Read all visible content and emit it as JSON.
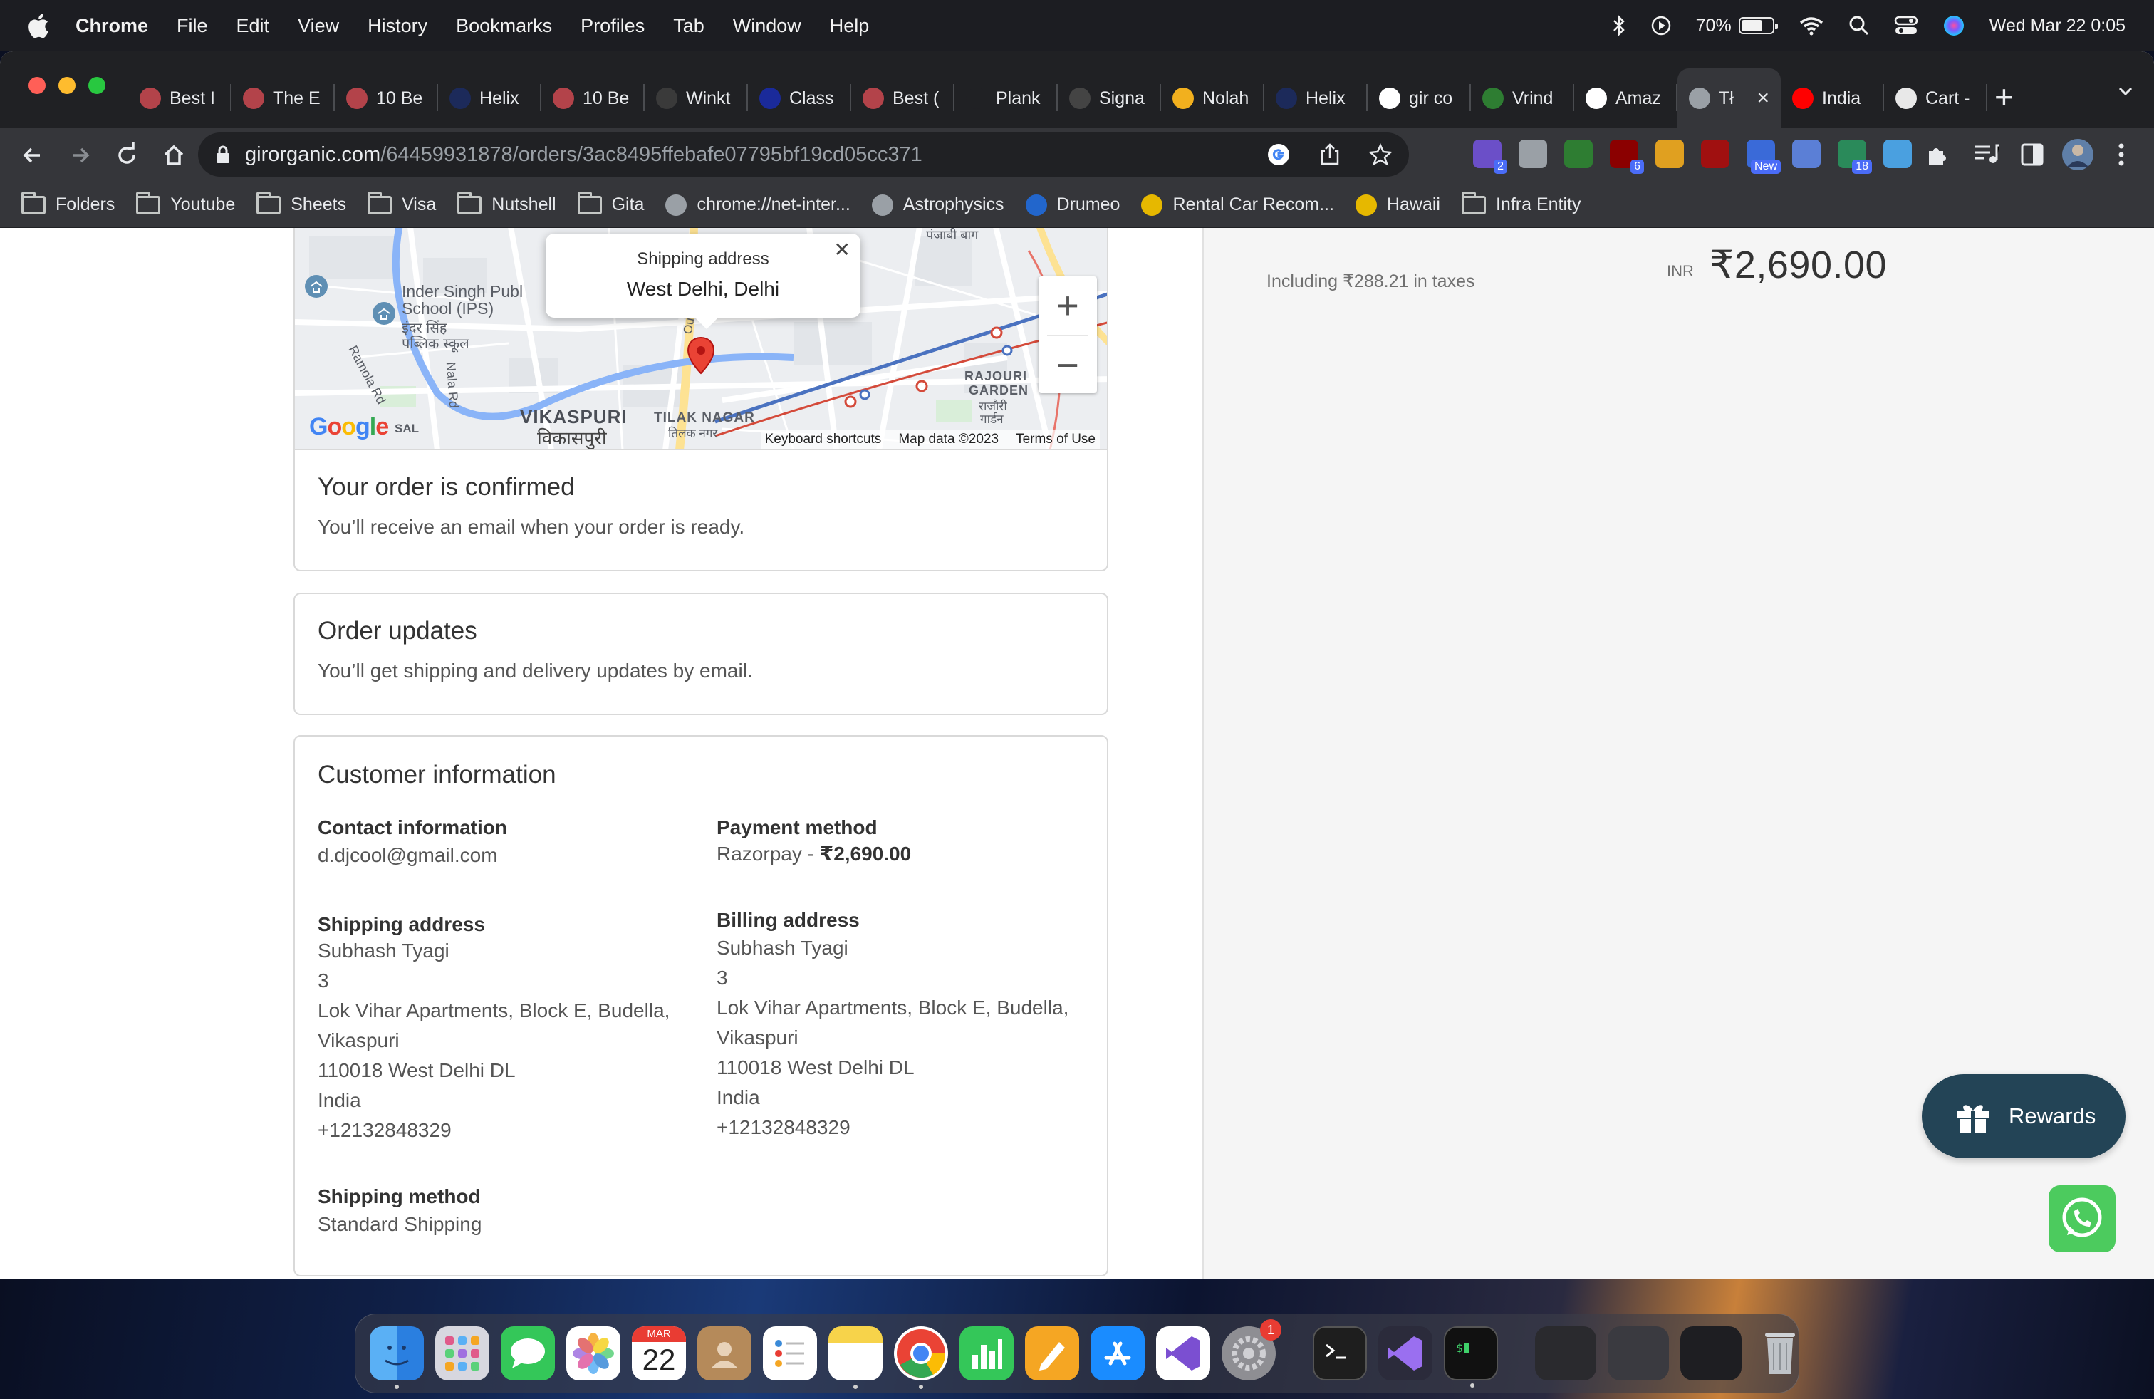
{
  "menubar": {
    "app_name": "Chrome",
    "items": [
      "File",
      "Edit",
      "View",
      "History",
      "Bookmarks",
      "Profiles",
      "Tab",
      "Window",
      "Help"
    ],
    "battery": "70%",
    "battery_level": 0.7,
    "clock": "Wed Mar 22  0:05"
  },
  "tabs": [
    {
      "title": "Best I",
      "fav_color": "#b3434a",
      "icon": "reddit-like-icon"
    },
    {
      "title": "The E",
      "fav_color": "#b3434a",
      "icon": "reddit-like-icon"
    },
    {
      "title": "10 Be",
      "fav_color": "#b3434a",
      "icon": "reddit-like-icon"
    },
    {
      "title": "Helix",
      "fav_color": "#1c2a5a",
      "icon": "helix-icon"
    },
    {
      "title": "10 Be",
      "fav_color": "#b3434a",
      "icon": "reddit-like-icon"
    },
    {
      "title": "Winkt",
      "fav_color": "#3a3a3a",
      "icon": "wikipedia-icon"
    },
    {
      "title": "Class",
      "fav_color": "#1a2a9a",
      "icon": "class-icon"
    },
    {
      "title": "Best (",
      "fav_color": "#b3434a",
      "icon": "reddit-like-icon"
    },
    {
      "title": "Plank",
      "fav_color": "#202124",
      "icon": "plank-icon"
    },
    {
      "title": "Signa",
      "fav_color": "#444444",
      "icon": "signal-icon"
    },
    {
      "title": "Nolah",
      "fav_color": "#f2b01e",
      "icon": "nolah-icon"
    },
    {
      "title": "Helix",
      "fav_color": "#1c2a5a",
      "icon": "helix-icon"
    },
    {
      "title": "gir co",
      "fav_color": "#ffffff",
      "icon": "google-icon"
    },
    {
      "title": "Vrind",
      "fav_color": "#2e7d32",
      "icon": "vrindavan-icon"
    },
    {
      "title": "Amaz",
      "fav_color": "#ffffff",
      "icon": "amazon-icon"
    },
    {
      "title": "Tł",
      "fav_color": "#9aa0a6",
      "icon": "globe-icon",
      "active": true
    },
    {
      "title": "India",
      "fav_color": "#ff0000",
      "icon": "youtube-icon"
    },
    {
      "title": "Cart -",
      "fav_color": "#e8e8e8",
      "icon": "cart-icon"
    }
  ],
  "omnibox": {
    "host": "girorganic.com",
    "path": "/64459931878/orders/3ac8495ffebafe07795bf19cd05cc371"
  },
  "extensions": [
    {
      "color": "#6b4fc8",
      "badge": "2",
      "icon": "ext-p-icon"
    },
    {
      "color": "#9aa0a6",
      "badge": "",
      "icon": "ext-translate-icon"
    },
    {
      "color": "#2e7d32",
      "badge": "",
      "icon": "ext-dollar-icon"
    },
    {
      "color": "#8b0000",
      "badge": "6",
      "icon": "ublock-icon"
    },
    {
      "color": "#e0a020",
      "badge": "",
      "icon": "ext-stack-icon"
    },
    {
      "color": "#a01010",
      "badge": "",
      "icon": "ext-y-icon"
    },
    {
      "color": "#3a6ad8",
      "badge": "New",
      "icon": "ext-new-icon"
    },
    {
      "color": "#5b7fd6",
      "badge": "",
      "icon": "ext-cloud-icon"
    },
    {
      "color": "#2a8a5a",
      "badge": "18",
      "icon": "ext-arrow-icon"
    },
    {
      "color": "#4aa0e0",
      "badge": "",
      "icon": "ext-square-icon"
    }
  ],
  "bookmarks": [
    {
      "label": "Folders",
      "type": "folder"
    },
    {
      "label": "Youtube",
      "type": "folder"
    },
    {
      "label": "Sheets",
      "type": "folder"
    },
    {
      "label": "Visa",
      "type": "folder"
    },
    {
      "label": "Nutshell",
      "type": "folder"
    },
    {
      "label": "Gita",
      "type": "folder"
    },
    {
      "label": "chrome://net-inter...",
      "type": "site",
      "color": "#9aa0a6"
    },
    {
      "label": "Astrophysics",
      "type": "site",
      "color": "#9aa0a6"
    },
    {
      "label": "Drumeo",
      "type": "site",
      "color": "#2266cc"
    },
    {
      "label": "Rental Car Recom...",
      "type": "site",
      "color": "#e6b800"
    },
    {
      "label": "Hawaii",
      "type": "site",
      "color": "#e6b800"
    },
    {
      "label": "Infra Entity",
      "type": "folder"
    }
  ],
  "map": {
    "popup_title": "Shipping address",
    "popup_place": "West Delhi, Delhi",
    "labels": {
      "school_en": "Inder Singh Publ",
      "school_en2": "School (IPS)",
      "school_hi": "इंदर सिंह",
      "school_hi2": "पब्लिक स्कूल",
      "road1": "Ramola Rd",
      "road2": "Nala Rd",
      "vikaspuri": "VIKASPURI",
      "vikaspuri_hi": "विकासपुरी",
      "tilak": "TILAK NAGAR",
      "tilak_hi": "तिलक नगर",
      "rajouri": "RAJOURI",
      "garden": "GARDEN",
      "rajouri_hi": "राजौरी",
      "garden_hi": "गार्डन",
      "punjabi": "पंजाबी बाग",
      "sal": "SAL",
      "outer": "Outer"
    },
    "attribution": [
      "Keyboard shortcuts",
      "Map data ©2023",
      "Terms of Use"
    ]
  },
  "order": {
    "confirmed_title": "Your order is confirmed",
    "confirmed_text": "You’ll receive an email when your order is ready.",
    "updates_title": "Order updates",
    "updates_text": "You’ll get shipping and delivery updates by email."
  },
  "customer": {
    "title": "Customer information",
    "contact_head": "Contact information",
    "contact_email": "d.djcool@gmail.com",
    "payment_head": "Payment method",
    "payment_provider": "Razorpay - ",
    "payment_amount": "₹2,690.00",
    "shipping_head": "Shipping address",
    "billing_head": "Billing address",
    "address_lines": [
      "Subhash Tyagi",
      "3",
      "Lok Vihar Apartments, Block E, Budella,",
      "Vikaspuri",
      "110018 West Delhi DL",
      "India",
      "+12132848329"
    ],
    "method_head": "Shipping method",
    "method_value": "Standard Shipping"
  },
  "summary": {
    "taxes": "Including ₹288.21 in taxes",
    "currency": "INR",
    "total": "₹2,690.00"
  },
  "widgets": {
    "rewards_label": "Rewards"
  },
  "dock": {
    "calendar_month": "MAR",
    "calendar_day": "22",
    "settings_badge": "1"
  }
}
